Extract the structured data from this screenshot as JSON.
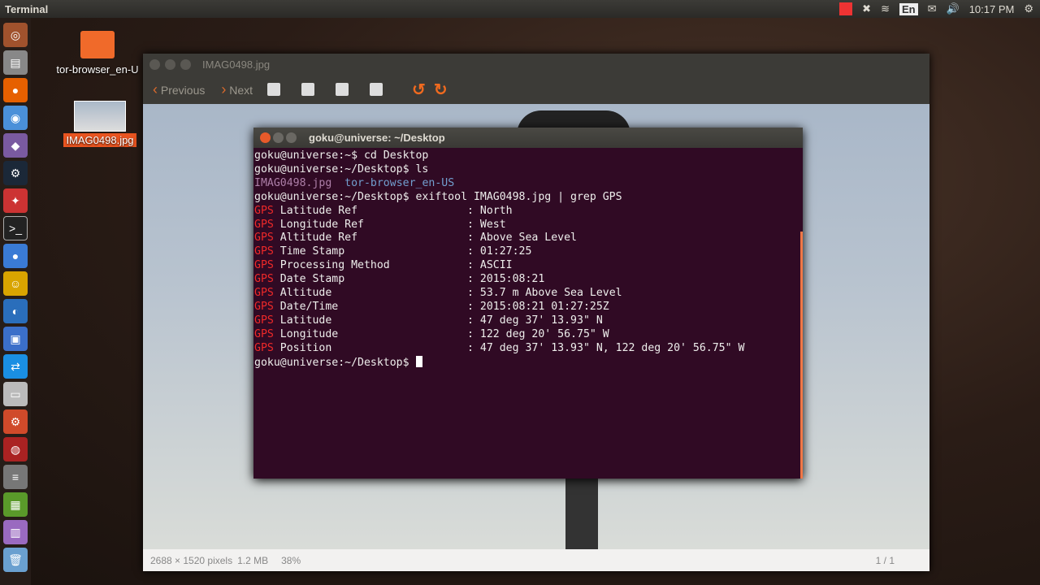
{
  "topbar": {
    "app_title": "Terminal",
    "lang": "En",
    "time": "10:17 PM"
  },
  "desktop": {
    "icons": [
      {
        "label": "tor-browser_en-U"
      },
      {
        "label": "IMAG0498.jpg"
      }
    ]
  },
  "viewer": {
    "title": "IMAG0498.jpg",
    "previous": "Previous",
    "next": "Next",
    "status": {
      "dimensions": "2688 × 1520 pixels",
      "size": "1.2 MB",
      "zoom": "38%",
      "page": "1 / 1"
    }
  },
  "terminal": {
    "title": "goku@universe: ~/Desktop",
    "prompt1": "goku@universe:~$ cd Desktop",
    "prompt2": "goku@universe:~/Desktop$ ls",
    "ls_file": "IMAG0498.jpg",
    "ls_dir": "tor-browser_en-US",
    "prompt3": "goku@universe:~/Desktop$ exiftool IMAG0498.jpg | grep GPS",
    "gps_prefix": "GPS",
    "rows": [
      {
        "label": " Latitude Ref                 : ",
        "value": "North"
      },
      {
        "label": " Longitude Ref                : ",
        "value": "West"
      },
      {
        "label": " Altitude Ref                 : ",
        "value": "Above Sea Level"
      },
      {
        "label": " Time Stamp                   : ",
        "value": "01:27:25"
      },
      {
        "label": " Processing Method            : ",
        "value": "ASCII"
      },
      {
        "label": " Date Stamp                   : ",
        "value": "2015:08:21"
      },
      {
        "label": " Altitude                     : ",
        "value": "53.7 m Above Sea Level"
      },
      {
        "label": " Date/Time                    : ",
        "value": "2015:08:21 01:27:25Z"
      },
      {
        "label": " Latitude                     : ",
        "value": "47 deg 37' 13.93\" N"
      },
      {
        "label": " Longitude                    : ",
        "value": "122 deg 20' 56.75\" W"
      },
      {
        "label": " Position                     : ",
        "value": "47 deg 37' 13.93\" N, 122 deg 20' 56.75\" W"
      }
    ],
    "prompt4": "goku@universe:~/Desktop$ "
  }
}
